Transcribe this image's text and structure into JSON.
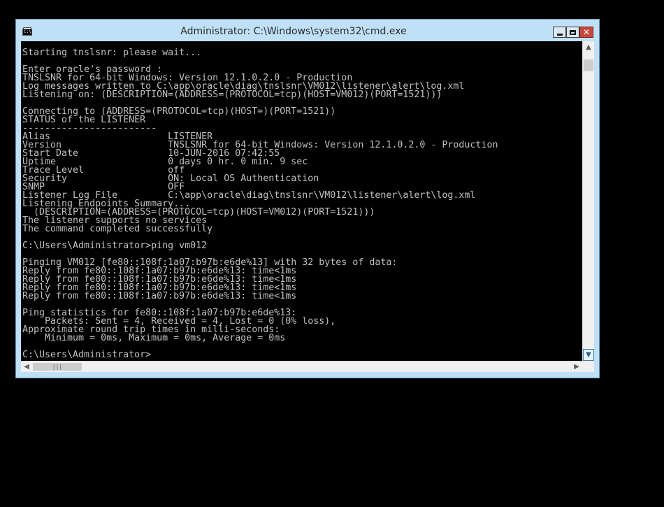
{
  "window": {
    "title": "Administrator: C:\\Windows\\system32\\cmd.exe",
    "icon": "cmd-console-icon",
    "icon_prompt": "C:\\",
    "controls": {
      "minimize_icon": "minimize-icon",
      "maximize_icon": "maximize-icon",
      "close_icon": "close-icon",
      "close_glyph": "✕"
    }
  },
  "console": {
    "background": "#000000",
    "text_color": "#c0c0c0",
    "text": "Starting tnslsnr: please wait...\n\nEnter oracle's password :\nTNSLSNR for 64-bit Windows: Version 12.1.0.2.0 - Production\nLog messages written to C:\\app\\oracle\\diag\\tnslsnr\\VM012\\listener\\alert\\log.xml\nListening on: (DESCRIPTION=(ADDRESS=(PROTOCOL=tcp)(HOST=VM012)(PORT=1521)))\n\nConnecting to (ADDRESS=(PROTOCOL=tcp)(HOST=)(PORT=1521))\nSTATUS of the LISTENER\n------------------------\nAlias                     LISTENER\nVersion                   TNSLSNR for 64-bit Windows: Version 12.1.0.2.0 - Production\nStart Date                10-JUN-2016 07:42:55\nUptime                    0 days 0 hr. 0 min. 9 sec\nTrace Level               off\nSecurity                  ON: Local OS Authentication\nSNMP                      OFF\nListener Log File         C:\\app\\oracle\\diag\\tnslsnr\\VM012\\listener\\alert\\log.xml\nListening Endpoints Summary...\n  (DESCRIPTION=(ADDRESS=(PROTOCOL=tcp)(HOST=VM012)(PORT=1521)))\nThe listener supports no services\nThe command completed successfully\n\nC:\\Users\\Administrator>ping vm012\n\nPinging VM012 [fe80::108f:1a07:b97b:e6de%13] with 32 bytes of data:\nReply from fe80::108f:1a07:b97b:e6de%13: time<1ms\nReply from fe80::108f:1a07:b97b:e6de%13: time<1ms\nReply from fe80::108f:1a07:b97b:e6de%13: time<1ms\nReply from fe80::108f:1a07:b97b:e6de%13: time<1ms\n\nPing statistics for fe80::108f:1a07:b97b:e6de%13:\n    Packets: Sent = 4, Received = 4, Lost = 0 (0% loss),\nApproximate round trip times in milli-seconds:\n    Minimum = 0ms, Maximum = 0ms, Average = 0ms\n\nC:\\Users\\Administrator>"
  },
  "scrollbars": {
    "up_arrow": "▲",
    "down_arrow": "▼",
    "left_arrow": "◀",
    "right_arrow": "▶",
    "h_thumb_grip": "|||"
  },
  "colors": {
    "frame": "#bfe0f7",
    "close_button": "#c7473b"
  }
}
